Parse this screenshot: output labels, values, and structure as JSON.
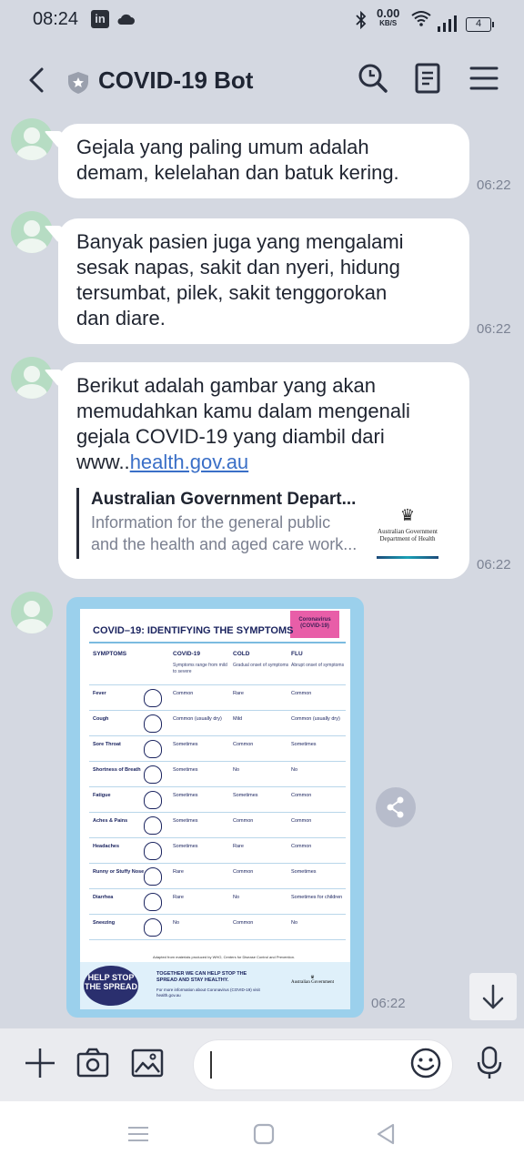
{
  "status_bar": {
    "time": "08:24",
    "net_speed": "0.00",
    "net_unit": "KB/S",
    "battery": "4"
  },
  "header": {
    "title": "COVID-19 Bot",
    "icons": [
      "back-arrow-icon",
      "shield-icon",
      "search-icon",
      "notes-icon",
      "menu-icon"
    ]
  },
  "messages": [
    {
      "text": "Gejala yang paling umum adalah\ndemam, kelelahan dan batuk kering.",
      "time": "06:22"
    },
    {
      "text": "Banyak pasien juga yang mengalami\nsesak napas, sakit dan nyeri, hidung\ntersumbat, pilek, sakit tenggorokan\ndan diare.",
      "time": "06:22"
    },
    {
      "text_before_link": "Berikut adalah gambar yang akan\nmemudahkan kamu dalam mengenali\ngejala COVID-19 yang diambil dari\nwww..",
      "link_text": "health.gov.au",
      "time": "06:22",
      "preview": {
        "title": "Australian Government Depart...",
        "description": "Information for the general public\nand the health and aged care work...",
        "logo_line1": "Australian Government",
        "logo_line2": "Department of Health"
      }
    }
  ],
  "image_message": {
    "time": "06:22",
    "poster": {
      "title": "COVID–19: IDENTIFYING THE SYMPTOMS",
      "badge": "Coronavirus (COVID-19)",
      "headers": [
        "SYMPTOMS",
        "COVID-19",
        "COLD",
        "FLU"
      ],
      "subheaders": [
        "",
        "Symptoms range from mild to severe",
        "Gradual onset of symptoms",
        "Abrupt onset of symptoms"
      ],
      "rows": [
        [
          "Fever",
          "Common",
          "Rare",
          "Common"
        ],
        [
          "Cough",
          "Common (usually dry)",
          "Mild",
          "Common (usually dry)"
        ],
        [
          "Sore Throat",
          "Sometimes",
          "Common",
          "Sometimes"
        ],
        [
          "Shortness of Breath",
          "Sometimes",
          "No",
          "No"
        ],
        [
          "Fatigue",
          "Sometimes",
          "Sometimes",
          "Common"
        ],
        [
          "Aches & Pains",
          "Sometimes",
          "Common",
          "Common"
        ],
        [
          "Headaches",
          "Sometimes",
          "Rare",
          "Common"
        ],
        [
          "Runny or Stuffy Nose",
          "Rare",
          "Common",
          "Sometimes"
        ],
        [
          "Diarrhea",
          "Rare",
          "No",
          "Sometimes for children"
        ],
        [
          "Sneezing",
          "No",
          "Common",
          "No"
        ]
      ],
      "adapted": "Adapted from materials produced by WHO, Centers for Disease Control and Prevention.",
      "stop_spread": "HELP STOP THE SPREAD",
      "footer_main": "TOGETHER WE CAN HELP STOP THE SPREAD AND STAY HEALTHY.",
      "footer_info": "For more information about Coronavirus (COVID-19) visit health.gov.au",
      "footer_logo": "Australian Government"
    }
  },
  "input_bar": {
    "placeholder": ""
  }
}
